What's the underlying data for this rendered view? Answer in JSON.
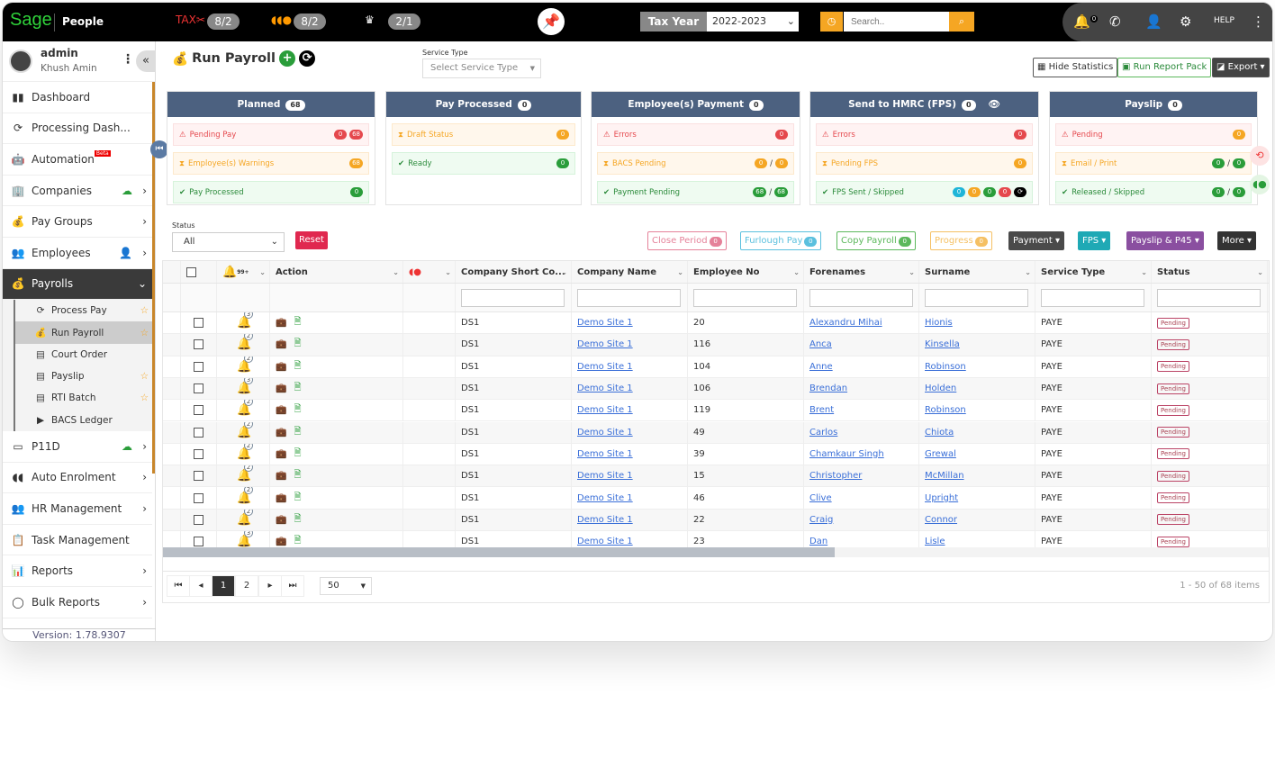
{
  "topbar": {
    "logo": "Sage",
    "product": "People",
    "tax_count": "8/2",
    "ae_count": "8/2",
    "gov_count": "2/1",
    "tax_year_label": "Tax Year",
    "tax_year": "2022-2023",
    "search_placeholder": "Search..",
    "notifications": "0"
  },
  "user": {
    "name": "admin",
    "role": "Khush Amin"
  },
  "sidebar": {
    "items": [
      {
        "label": "Dashboard",
        "icon": "bar-chart-icon"
      },
      {
        "label": "Processing Dash...",
        "icon": "pound-cycle-icon"
      },
      {
        "label": "Automation",
        "icon": "robot-icon",
        "badge": "Beta"
      },
      {
        "label": "Companies",
        "icon": "building-icon",
        "chev": true,
        "extra": "cloud-upload"
      },
      {
        "label": "Pay Groups",
        "icon": "money-bags-icon",
        "chev": true
      },
      {
        "label": "Employees",
        "icon": "people-icon",
        "chev": true,
        "extra": "user-upload"
      },
      {
        "label": "Payrolls",
        "icon": "money-bag-icon",
        "active": true
      }
    ],
    "sub": [
      {
        "label": "Process Pay",
        "star": true
      },
      {
        "label": "Run Payroll",
        "star": true,
        "active": true
      },
      {
        "label": "Court Order"
      },
      {
        "label": "Payslip",
        "star": true
      },
      {
        "label": "RTI Batch",
        "star": true
      },
      {
        "label": "BACS Ledger"
      }
    ],
    "items2": [
      {
        "label": "P11D",
        "chev": true,
        "extra": "cloud-upload"
      },
      {
        "label": "Auto Enrolment",
        "chev": true
      },
      {
        "label": "HR Management",
        "chev": true
      },
      {
        "label": "Task Management"
      },
      {
        "label": "Reports",
        "chev": true
      },
      {
        "label": "Bulk Reports",
        "chev": true
      }
    ],
    "version": "Version: 1.78.9307"
  },
  "page": {
    "title": "Run Payroll",
    "service_type_label": "Service Type",
    "service_type_placeholder": "Select Service Type",
    "hide_stats": "Hide Statistics",
    "run_report_pack": "Run Report Pack",
    "export": "Export"
  },
  "cards": [
    {
      "title": "Planned",
      "count": "68",
      "rows": [
        {
          "label": "Pending Pay",
          "tone": "red",
          "badges": [
            [
              "0",
              "#e5484d"
            ],
            [
              "68",
              "#e5484d"
            ]
          ]
        },
        {
          "label": "Employee(s) Warnings",
          "tone": "ora",
          "badges": [
            [
              "68",
              "#f5a623"
            ]
          ]
        },
        {
          "label": "Pay Processed",
          "tone": "grn",
          "badges": [
            [
              "0",
              "#2a9d3a"
            ]
          ]
        }
      ]
    },
    {
      "title": "Pay Processed",
      "count": "0",
      "rows": [
        {
          "label": "Draft Status",
          "tone": "ora",
          "badges": [
            [
              "0",
              "#f5a623"
            ]
          ]
        },
        {
          "label": "Ready",
          "tone": "grn",
          "badges": [
            [
              "0",
              "#2a9d3a"
            ]
          ]
        }
      ]
    },
    {
      "title": "Employee(s) Payment",
      "count": "0",
      "rows": [
        {
          "label": "Errors",
          "tone": "red",
          "badges": [
            [
              "0",
              "#e5484d"
            ]
          ]
        },
        {
          "label": "BACS Pending",
          "tone": "ora",
          "badges": [
            [
              "0",
              "#f5a623"
            ],
            [
              "0",
              "#f5a623"
            ]
          ],
          "slash": true
        },
        {
          "label": "Payment Pending",
          "tone": "grn",
          "badges": [
            [
              "68",
              "#2a9d3a"
            ],
            [
              "68",
              "#2a9d3a"
            ]
          ],
          "slash": true
        }
      ]
    },
    {
      "title": "Send to HMRC (FPS)",
      "count": "0",
      "eye": true,
      "rows": [
        {
          "label": "Errors",
          "tone": "red",
          "badges": [
            [
              "0",
              "#e5484d"
            ]
          ]
        },
        {
          "label": "Pending FPS",
          "tone": "ora",
          "badges": [
            [
              "0",
              "#f5a623"
            ]
          ]
        },
        {
          "label": "FPS Sent / Skipped",
          "tone": "grn",
          "badges": [
            [
              "0",
              "#1fb5d8"
            ],
            [
              "0",
              "#f5a623"
            ],
            [
              "0",
              "#2a9d3a"
            ],
            [
              "0",
              "#e5484d"
            ]
          ],
          "sync": true
        }
      ]
    },
    {
      "title": "Payslip",
      "count": "0",
      "rows": [
        {
          "label": "Pending",
          "tone": "red",
          "badges": [
            [
              "0",
              "#f5a623"
            ]
          ]
        },
        {
          "label": "Email / Print",
          "tone": "ora",
          "badges": [
            [
              "0",
              "#2a9d3a"
            ],
            [
              "0",
              "#2a9d3a"
            ]
          ],
          "slash": true
        },
        {
          "label": "Released / Skipped",
          "tone": "grn",
          "badges": [
            [
              "0",
              "#2a9d3a"
            ],
            [
              "0",
              "#2a9d3a"
            ]
          ],
          "slash": true
        }
      ]
    }
  ],
  "filters": {
    "status_label": "Status",
    "status_value": "All",
    "reset": "Reset"
  },
  "toolbar": [
    {
      "label": "Close Period",
      "count": "0",
      "color": "#e5829a"
    },
    {
      "label": "Furlough Pay",
      "count": "0",
      "color": "#5bc0de"
    },
    {
      "label": "Copy Payroll",
      "count": "0",
      "color": "#5cb85c"
    },
    {
      "label": "Progress",
      "count": "0",
      "color": "#f5c063"
    },
    {
      "label": "Payment ▾",
      "fill": "#4a4a4a"
    },
    {
      "label": "FPS ▾",
      "fill": "#1fa9b5"
    },
    {
      "label": "Payslip & P45 ▾",
      "fill": "#8a4fa0"
    },
    {
      "label": "More ▾",
      "fill": "#333"
    }
  ],
  "table": {
    "bell_header_count": "99+",
    "columns": [
      "Action",
      "Company Short Co...",
      "Company Name",
      "Employee No",
      "Forenames",
      "Surname",
      "Service Type",
      "Status"
    ],
    "rows": [
      {
        "alerts": "3",
        "short": "DS1",
        "company": "Demo Site 1",
        "emp": "20",
        "fore": "Alexandru Mihai",
        "sur": "Hionis",
        "svc": "PAYE",
        "status": "Pending"
      },
      {
        "alerts": "2",
        "short": "DS1",
        "company": "Demo Site 1",
        "emp": "116",
        "fore": "Anca",
        "sur": "Kinsella",
        "svc": "PAYE",
        "status": "Pending"
      },
      {
        "alerts": "2",
        "short": "DS1",
        "company": "Demo Site 1",
        "emp": "104",
        "fore": "Anne",
        "sur": "Robinson",
        "svc": "PAYE",
        "status": "Pending"
      },
      {
        "alerts": "3",
        "short": "DS1",
        "company": "Demo Site 1",
        "emp": "106",
        "fore": "Brendan",
        "sur": "Holden",
        "svc": "PAYE",
        "status": "Pending"
      },
      {
        "alerts": "2",
        "short": "DS1",
        "company": "Demo Site 1",
        "emp": "119",
        "fore": "Brent",
        "sur": "Robinson",
        "svc": "PAYE",
        "status": "Pending"
      },
      {
        "alerts": "2",
        "short": "DS1",
        "company": "Demo Site 1",
        "emp": "49",
        "fore": "Carlos",
        "sur": "Chiota",
        "svc": "PAYE",
        "status": "Pending"
      },
      {
        "alerts": "2",
        "short": "DS1",
        "company": "Demo Site 1",
        "emp": "39",
        "fore": "Chamkaur Singh",
        "sur": "Grewal",
        "svc": "PAYE",
        "status": "Pending"
      },
      {
        "alerts": "2",
        "short": "DS1",
        "company": "Demo Site 1",
        "emp": "15",
        "fore": "Christopher",
        "sur": "McMillan",
        "svc": "PAYE",
        "status": "Pending"
      },
      {
        "alerts": "2",
        "short": "DS1",
        "company": "Demo Site 1",
        "emp": "46",
        "fore": "Clive",
        "sur": "Upright",
        "svc": "PAYE",
        "status": "Pending"
      },
      {
        "alerts": "2",
        "short": "DS1",
        "company": "Demo Site 1",
        "emp": "22",
        "fore": "Craig",
        "sur": "Connor",
        "svc": "PAYE",
        "status": "Pending"
      },
      {
        "alerts": "3",
        "short": "DS1",
        "company": "Demo Site 1",
        "emp": "23",
        "fore": "Dan",
        "sur": "Lisle",
        "svc": "PAYE",
        "status": "Pending"
      }
    ]
  },
  "pager": {
    "pages": [
      "1",
      "2"
    ],
    "current": "1",
    "page_size": "50",
    "info": "1 - 50 of 68 items"
  }
}
